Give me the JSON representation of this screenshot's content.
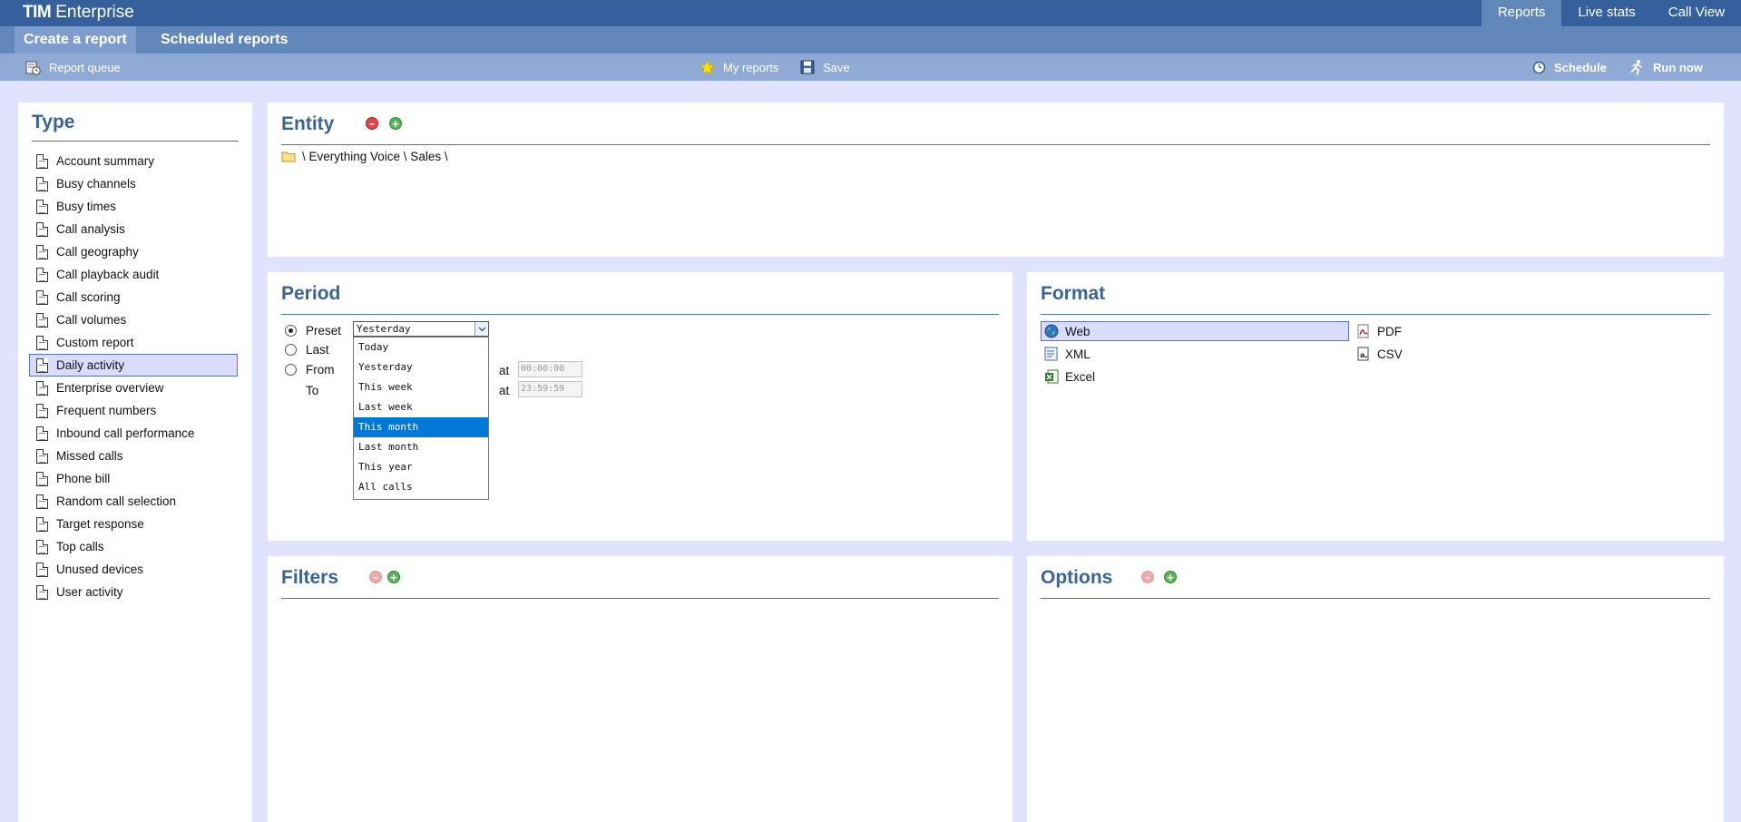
{
  "brand": {
    "strong": "TIM",
    "light": "Enterprise"
  },
  "topnav": [
    "Reports",
    "Live stats",
    "Call View"
  ],
  "tabs": {
    "active": "Create a report",
    "inactive": "Scheduled reports"
  },
  "toolbar": {
    "report_queue": "Report queue",
    "my_reports": "My reports",
    "save": "Save",
    "schedule": "Schedule",
    "run_now": "Run now"
  },
  "type_panel": {
    "title": "Type",
    "selected": "Daily activity",
    "items": [
      "Account summary",
      "Busy channels",
      "Busy times",
      "Call analysis",
      "Call geography",
      "Call playback audit",
      "Call scoring",
      "Call volumes",
      "Custom report",
      "Daily activity",
      "Enterprise overview",
      "Frequent numbers",
      "Inbound call performance",
      "Missed calls",
      "Phone bill",
      "Random call selection",
      "Target response",
      "Top calls",
      "Unused devices",
      "User activity"
    ]
  },
  "entity_panel": {
    "title": "Entity",
    "path": "\\ Everything Voice \\ Sales \\"
  },
  "period_panel": {
    "title": "Period",
    "labels": {
      "preset": "Preset",
      "last": "Last",
      "from": "From",
      "to": "To",
      "at": "at"
    },
    "preset_value": "Yesterday",
    "options": [
      "Today",
      "Yesterday",
      "This week",
      "Last week",
      "This month",
      "Last month",
      "This year",
      "All calls"
    ],
    "highlighted_option": "This month",
    "from_time": "00:00:00",
    "to_time": "23:59:59"
  },
  "format_panel": {
    "title": "Format",
    "selected": "Web",
    "items": {
      "web": "Web",
      "pdf": "PDF",
      "xml": "XML",
      "csv": "CSV",
      "excel": "Excel"
    }
  },
  "filters_panel": {
    "title": "Filters"
  },
  "options_panel": {
    "title": "Options"
  },
  "colors": {
    "topbar": "#36609c",
    "tabbar": "#6288ba",
    "toolbar": "#90aad6",
    "background": "#e1e2fe",
    "title": "#3a6497",
    "selection": "#dadcfd",
    "dropdown_highlight": "#0078d7"
  }
}
